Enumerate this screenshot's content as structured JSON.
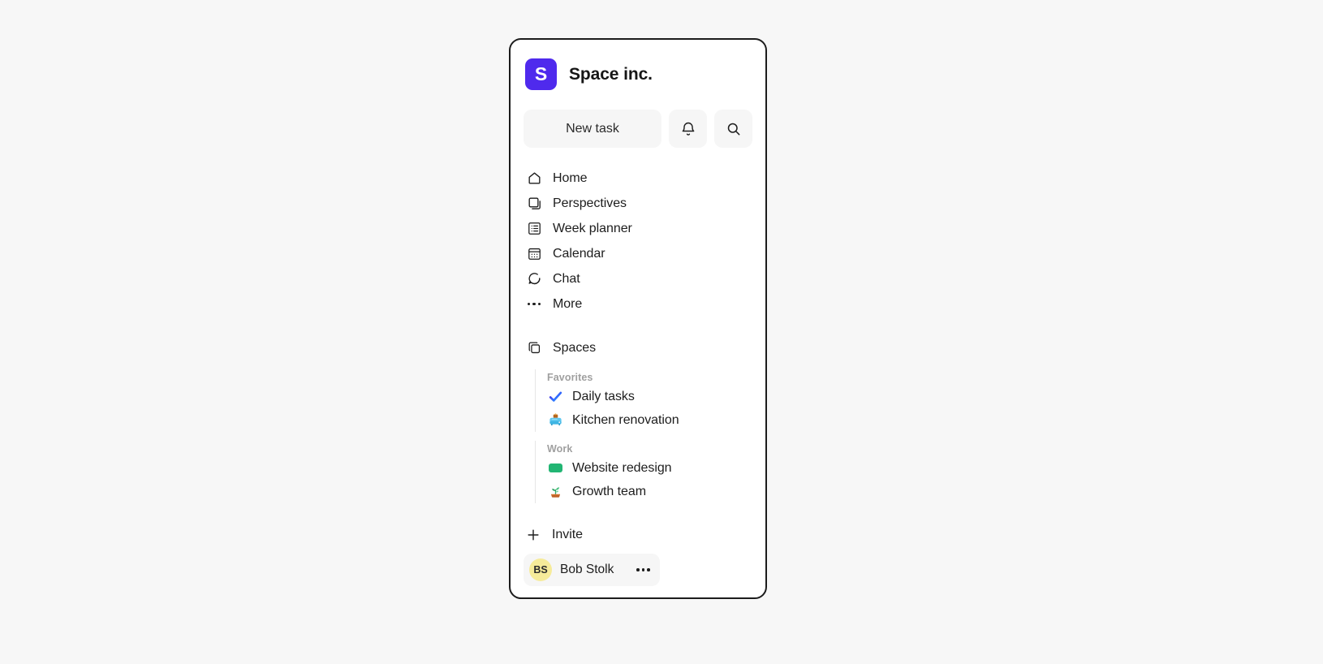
{
  "workspace": {
    "logo_letter": "S",
    "logo_color": "#4f2aed",
    "name": "Space inc."
  },
  "actions": {
    "new_task_label": "New task",
    "notifications_icon": "bell-icon",
    "search_icon": "search-icon"
  },
  "nav": {
    "items": [
      {
        "label": "Home",
        "icon": "home-icon"
      },
      {
        "label": "Perspectives",
        "icon": "square-stack-icon"
      },
      {
        "label": "Week planner",
        "icon": "list-view-icon"
      },
      {
        "label": "Calendar",
        "icon": "calendar-icon"
      },
      {
        "label": "Chat",
        "icon": "chat-bubble-icon"
      },
      {
        "label": "More",
        "icon": "ellipsis-icon"
      }
    ]
  },
  "spaces": {
    "header_label": "Spaces",
    "header_icon": "layers-icon",
    "groups": [
      {
        "title": "Favorites",
        "items": [
          {
            "label": "Daily tasks",
            "icon": "check-mark-emoji"
          },
          {
            "label": "Kitchen renovation",
            "icon": "toaster-emoji"
          }
        ]
      },
      {
        "title": "Work",
        "items": [
          {
            "label": "Website redesign",
            "icon": "green-swatch",
            "color": "#22b573"
          },
          {
            "label": "Growth team",
            "icon": "seedling-emoji"
          }
        ]
      }
    ]
  },
  "footer": {
    "invite_label": "Invite",
    "invite_icon": "plus-icon",
    "profile": {
      "initials": "BS",
      "name": "Bob Stolk",
      "avatar_color": "#f6eb9a",
      "more_icon": "ellipsis-icon"
    }
  }
}
